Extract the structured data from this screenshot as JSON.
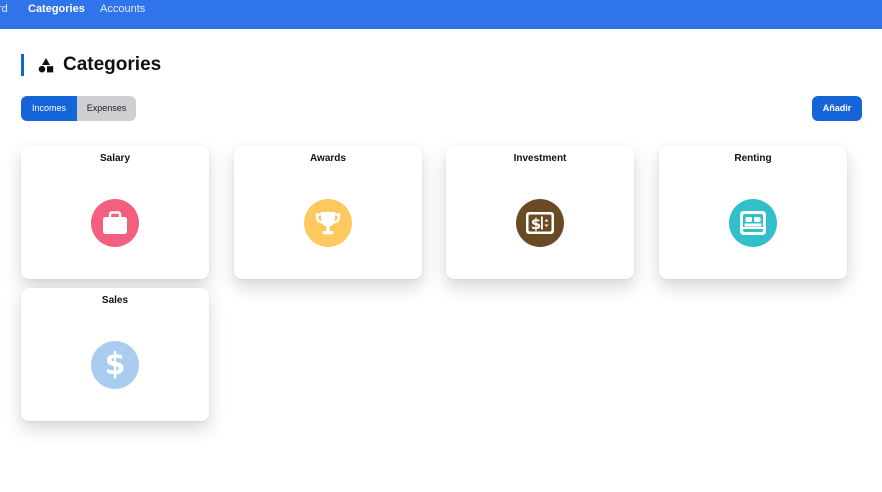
{
  "nav": {
    "items": [
      {
        "label": "rd",
        "active": false
      },
      {
        "label": "Categories",
        "active": true
      },
      {
        "label": "Accounts",
        "active": false
      }
    ]
  },
  "page": {
    "title": "Categories",
    "title_icon": "shapes-icon"
  },
  "tabs": {
    "incomes": "Incomes",
    "expenses": "Expenses",
    "selected": "Incomes"
  },
  "add_button": "Añadir",
  "categories": [
    {
      "name": "Salary",
      "icon": "briefcase-icon",
      "color": "#f25f7f"
    },
    {
      "name": "Awards",
      "icon": "trophy-icon",
      "color": "#fdc85f"
    },
    {
      "name": "Investment",
      "icon": "money-bill-icon",
      "color": "#6a4a25"
    },
    {
      "name": "Renting",
      "icon": "bed-icon",
      "color": "#31bfc9"
    },
    {
      "name": "Sales",
      "icon": "dollar-icon",
      "color": "#a9cdee"
    }
  ],
  "colors": {
    "nav_bg": "#2f74eb",
    "accent": "#1665d8",
    "segment_inactive": "#cfcfd3"
  }
}
